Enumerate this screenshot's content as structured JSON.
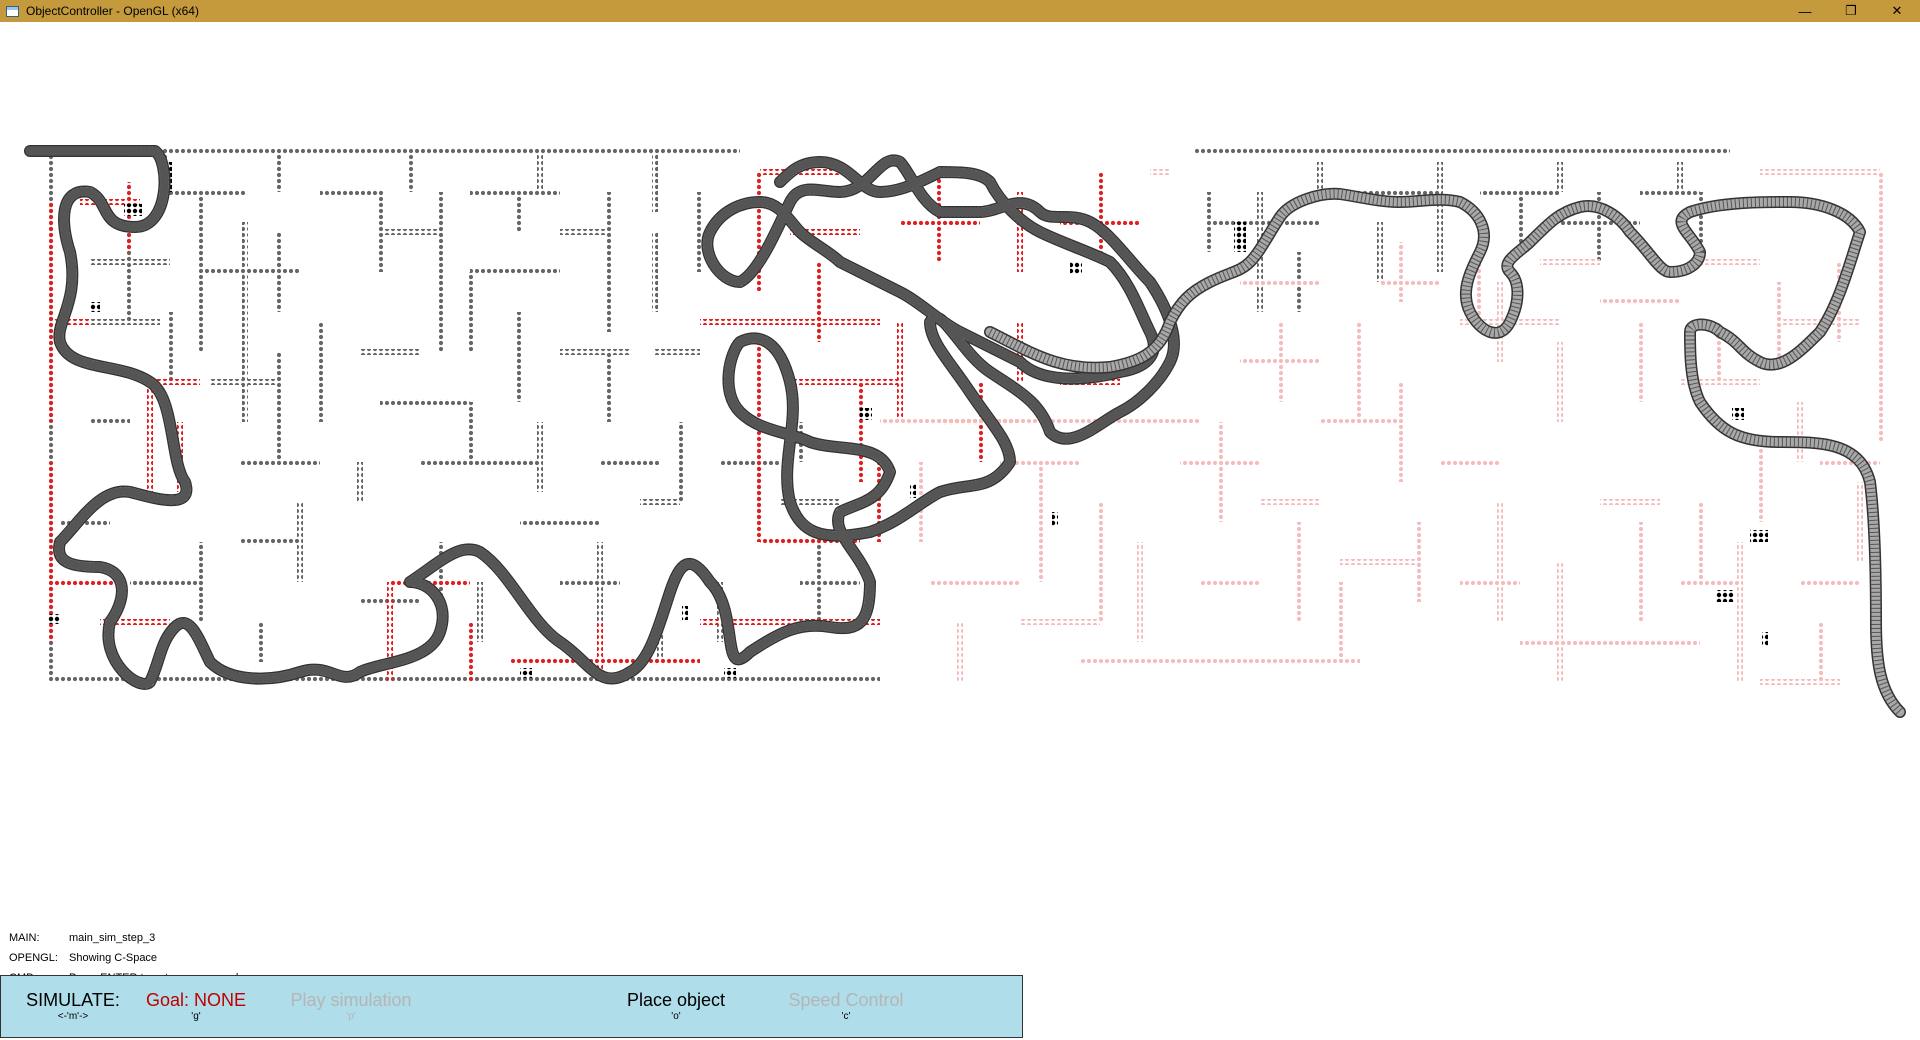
{
  "window": {
    "title": "ObjectController - OpenGL (x64)",
    "minimize": "—",
    "restore": "❐",
    "close": "✕"
  },
  "colors": {
    "titlebar": "#c49a3c",
    "maze_visited_dark": "#555555",
    "maze_red": "#e02020",
    "maze_pink": "#f5bcbc",
    "maze_black": "#000000",
    "path": "#888888",
    "toolbar_bg": "#afdde9",
    "goal_text": "#c00000",
    "disabled_text": "#b5b5b5"
  },
  "status": {
    "main_key": "MAIN:",
    "main_value": "main_sim_step_3",
    "opengl_key": "OPENGL:",
    "opengl_value": "Showing C-Space",
    "cmd_key": "CMD:",
    "cmd_value": "Press ENTER to enter a command"
  },
  "toolbar": {
    "simulate_label": "SIMULATE:",
    "simulate_key": "<-'m'->",
    "goal_label": "Goal: NONE",
    "goal_key": "'g'",
    "play_label": "Play simulation",
    "play_key": "'p'",
    "place_label": "Place object",
    "place_key": "'o'",
    "speed_label": "Speed Control",
    "speed_key": "'c'"
  },
  "icons": {
    "app": "app-window-icon",
    "min": "minimize-icon",
    "restore": "restore-icon",
    "close": "close-icon"
  }
}
